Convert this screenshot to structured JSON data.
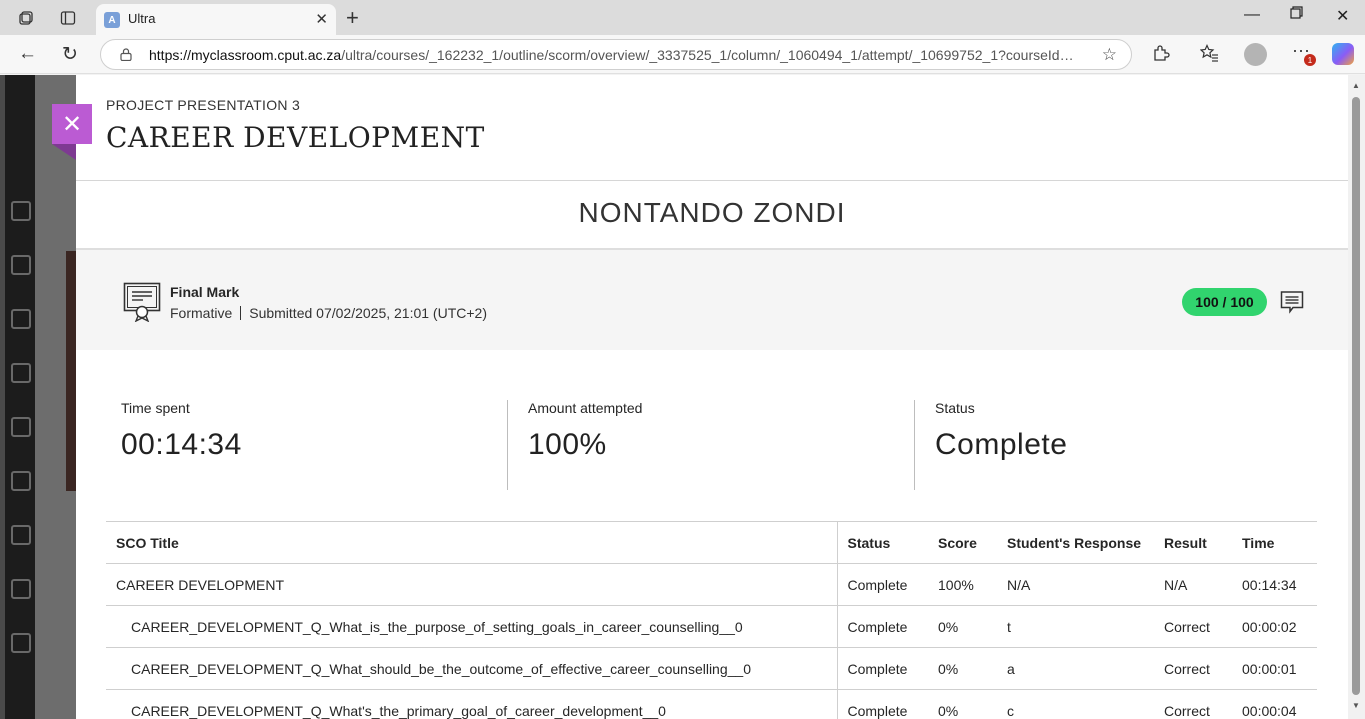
{
  "browser": {
    "tab_title": "Ultra",
    "tab_favicon": "A",
    "url_host": "https://myclassroom.cput.ac.za",
    "url_path": "/ultra/courses/_162232_1/outline/scorm/overview/_3337525_1/column/_1060494_1/attempt/_10699752_1?courseId=_…",
    "notification_count": "1",
    "icons": [
      "workspaces-icon",
      "tab-actions-icon",
      "back-icon",
      "refresh-icon",
      "lock-icon",
      "favorite-star-icon",
      "extensions-icon",
      "favorites-icon",
      "profile-icon",
      "more-icon",
      "copilot-icon"
    ]
  },
  "panel": {
    "label": "PROJECT PRESENTATION 3",
    "title": "CAREER DEVELOPMENT",
    "student_name": "NONTANDO ZONDI",
    "grade": {
      "heading": "Final Mark",
      "type": "Formative",
      "submitted": "Submitted 07/02/2025, 21:01 (UTC+2)",
      "score": "100 / 100",
      "score_color": "#31d46e"
    },
    "stats": {
      "time_spent_label": "Time spent",
      "time_spent_value": "00:14:34",
      "attempted_label": "Amount attempted",
      "attempted_value": "100%",
      "status_label": "Status",
      "status_value": "Complete"
    },
    "table": {
      "headers": {
        "title": "SCO Title",
        "status": "Status",
        "score": "Score",
        "response": "Student's Response",
        "result": "Result",
        "time": "Time"
      },
      "rows": [
        {
          "title": "CAREER DEVELOPMENT",
          "status": "Complete",
          "score": "100%",
          "response": "N/A",
          "result": "N/A",
          "time": "00:14:34"
        },
        {
          "title": "CAREER_DEVELOPMENT_Q_What_is_the_purpose_of_setting_goals_in_career_counselling__0",
          "status": "Complete",
          "score": "0%",
          "response": "t",
          "result": "Correct",
          "time": "00:00:02"
        },
        {
          "title": "CAREER_DEVELOPMENT_Q_What_should_be_the_outcome_of_effective_career_counselling__0",
          "status": "Complete",
          "score": "0%",
          "response": "a",
          "result": "Correct",
          "time": "00:00:01"
        },
        {
          "title": "CAREER_DEVELOPMENT_Q_What's_the_primary_goal_of_career_development__0",
          "status": "Complete",
          "score": "0%",
          "response": "c",
          "result": "Correct",
          "time": "00:00:04"
        }
      ]
    }
  },
  "colors": {
    "close_button": "#bb5bd3",
    "accent_purple": "#7e3a92"
  }
}
